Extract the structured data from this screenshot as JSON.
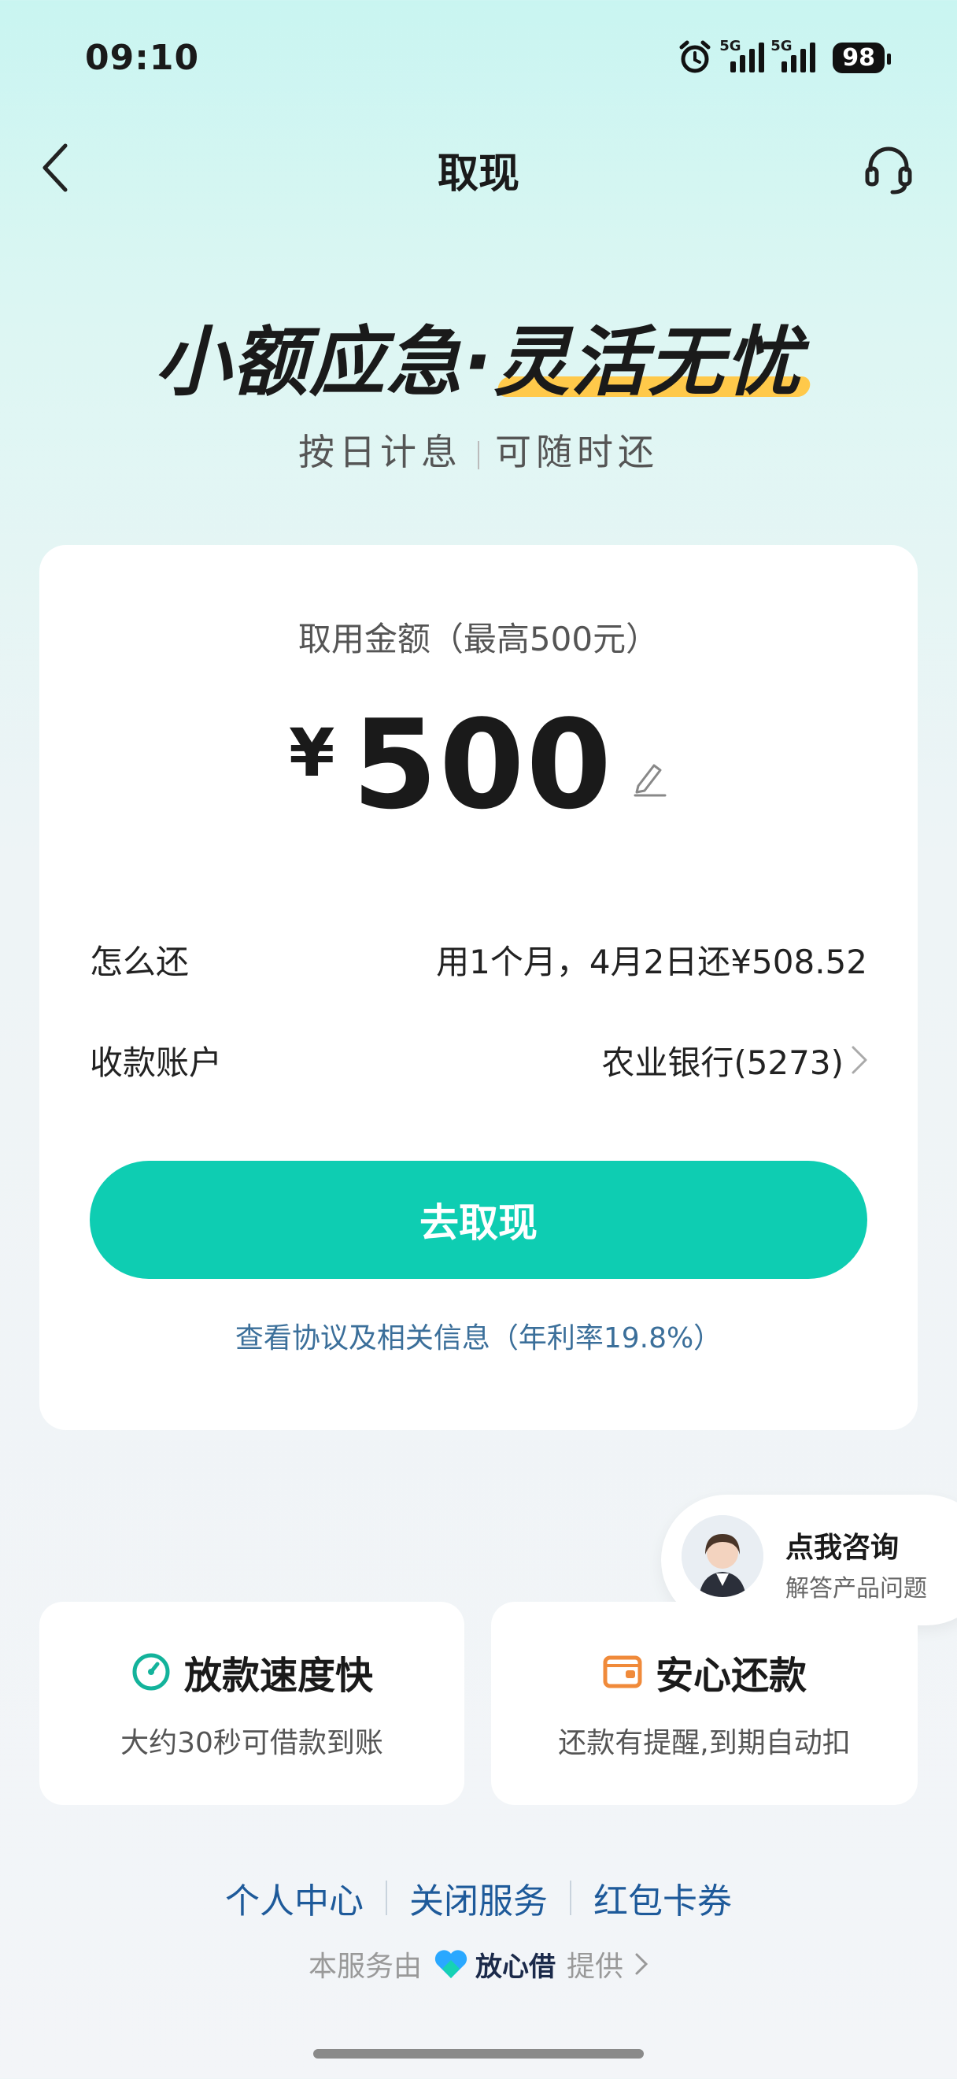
{
  "status": {
    "time": "09:10",
    "net1": "5G",
    "net2": "5G",
    "battery": "98"
  },
  "nav": {
    "title": "取现",
    "back_icon": "chevron-left-icon",
    "service_icon": "headset-icon"
  },
  "hero": {
    "title_part1": "小额应急·",
    "title_part2": "灵活无忧",
    "sub_left": "按日计息",
    "sub_right": "可随时还"
  },
  "amount": {
    "label": "取用金额（最高500元）",
    "currency": "¥",
    "value": "500"
  },
  "repay": {
    "label": "怎么还",
    "value": "用1个月，4月2日还¥508.52"
  },
  "account": {
    "label": "收款账户",
    "value": "农业银行(5273)"
  },
  "action": {
    "button": "去取现",
    "agreement": "查看协议及相关信息（年利率19.8%）"
  },
  "consult": {
    "title": "点我咨询",
    "subtitle": "解答产品问题"
  },
  "features": [
    {
      "title": "放款速度快",
      "desc": "大约30秒可借款到账",
      "icon": "speed-gauge-icon",
      "color": "#13b39b"
    },
    {
      "title": "安心还款",
      "desc": "还款有提醒,到期自动扣",
      "icon": "wallet-icon",
      "color": "#f08a3a"
    }
  ],
  "links": [
    "个人中心",
    "关闭服务",
    "红包卡券"
  ],
  "provider": {
    "prefix": "本服务由",
    "brand": "放心借",
    "suffix": "提供"
  },
  "colors": {
    "accent": "#0ecdb2",
    "link": "#1e5a9a"
  }
}
